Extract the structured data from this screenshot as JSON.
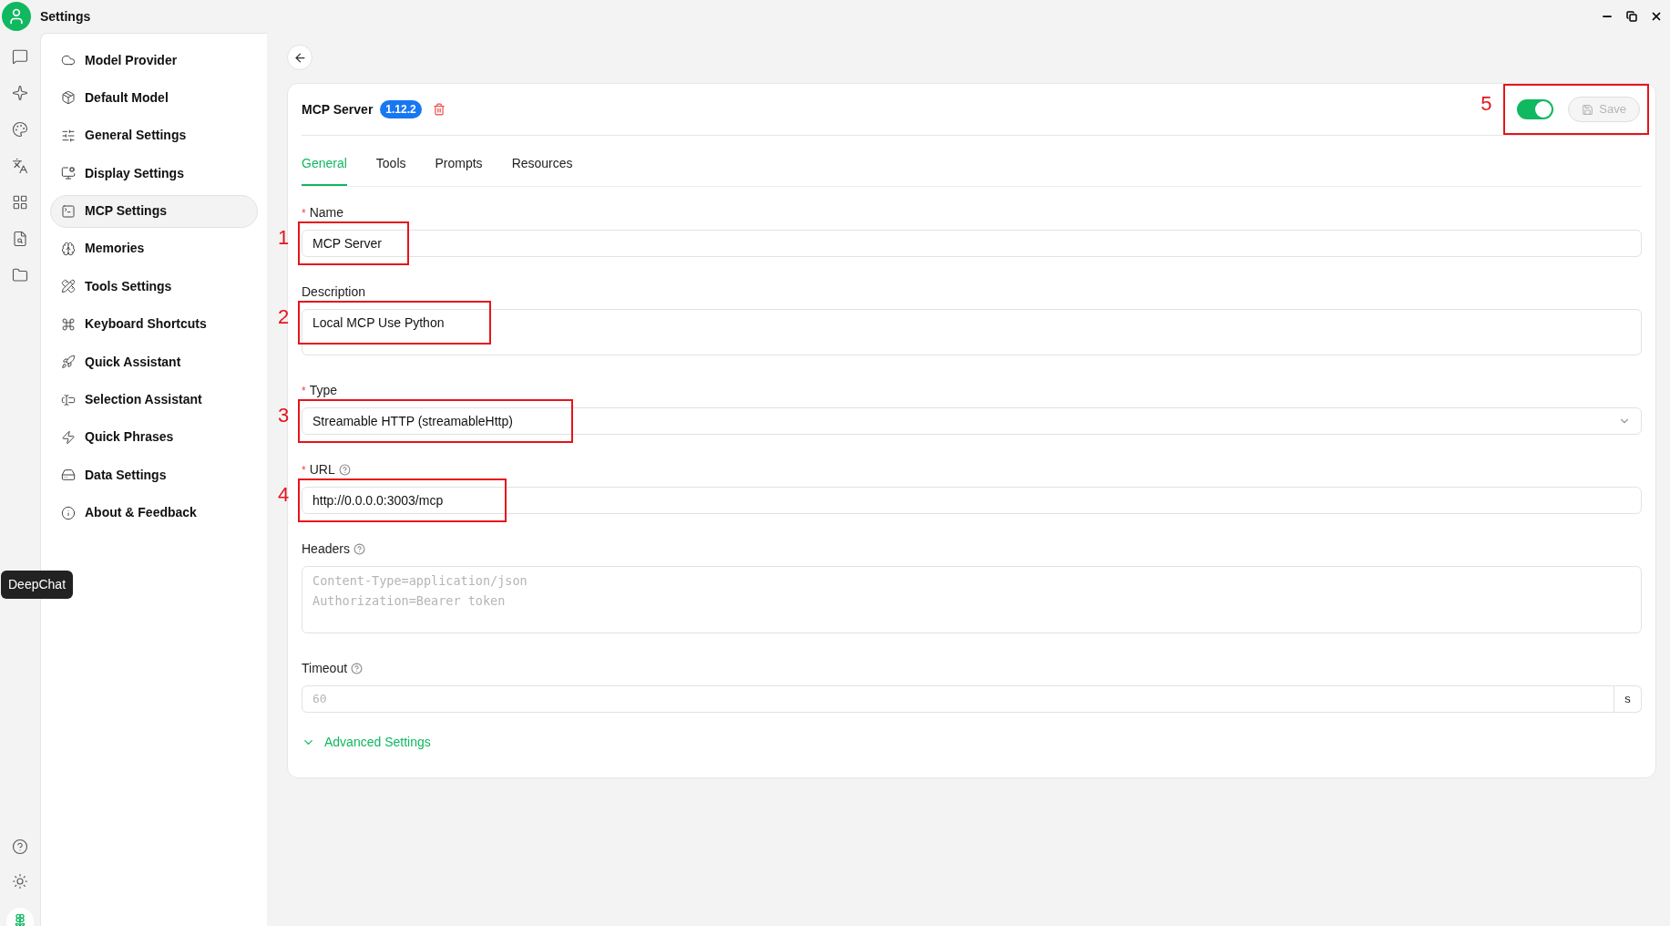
{
  "window": {
    "title": "Settings"
  },
  "rail": {
    "top": [
      {
        "kind": "chat"
      },
      {
        "kind": "sparkle"
      },
      {
        "kind": "palette"
      },
      {
        "kind": "translate"
      },
      {
        "kind": "grid"
      },
      {
        "kind": "file"
      },
      {
        "kind": "folder"
      }
    ],
    "bottom": [
      {
        "kind": "help"
      },
      {
        "kind": "sun"
      },
      {
        "kind": "flower"
      }
    ]
  },
  "tooltip": "DeepChat",
  "sidebar": {
    "items": [
      {
        "label": "Model Provider",
        "selected": false
      },
      {
        "label": "Default Model",
        "selected": false
      },
      {
        "label": "General Settings",
        "selected": false
      },
      {
        "label": "Display Settings",
        "selected": false
      },
      {
        "label": "MCP Settings",
        "selected": true
      },
      {
        "label": "Memories",
        "selected": false
      },
      {
        "label": "Tools Settings",
        "selected": false
      },
      {
        "label": "Keyboard Shortcuts",
        "selected": false
      },
      {
        "label": "Quick Assistant",
        "selected": false
      },
      {
        "label": "Selection Assistant",
        "selected": false
      },
      {
        "label": "Quick Phrases",
        "selected": false
      },
      {
        "label": "Data Settings",
        "selected": false
      },
      {
        "label": "About & Feedback",
        "selected": false
      }
    ]
  },
  "server": {
    "title": "MCP Server",
    "version": "1.12.2",
    "enabled": true,
    "save": {
      "label": "Save",
      "disabled": true
    },
    "annotation": "5"
  },
  "tabs": [
    {
      "label": "General",
      "selected": true
    },
    {
      "label": "Tools",
      "selected": false
    },
    {
      "label": "Prompts",
      "selected": false
    },
    {
      "label": "Resources",
      "selected": false
    }
  ],
  "fields": [
    {
      "kind": "text",
      "required_mark": "*",
      "label": "Name",
      "value": "MCP Server",
      "annotation": "1"
    },
    {
      "kind": "textarea",
      "label": "Description",
      "value": "Local MCP  Use Python",
      "annotation": "2"
    },
    {
      "kind": "select",
      "required_mark": "*",
      "label": "Type",
      "value": "Streamable HTTP (streamableHttp)",
      "annotation": "3"
    },
    {
      "kind": "text",
      "required_mark": "*",
      "label": "URL",
      "help": true,
      "value": "http://0.0.0.0:3003/mcp",
      "annotation": "4"
    },
    {
      "kind": "code",
      "label": "Headers",
      "help": true,
      "placeholder": "Content-Type=application/json\nAuthorization=Bearer token"
    },
    {
      "kind": "number",
      "label": "Timeout",
      "help": true,
      "placeholder": "60",
      "suffix": "s"
    }
  ],
  "advanced": {
    "label": "Advanced Settings",
    "expanded": false
  }
}
